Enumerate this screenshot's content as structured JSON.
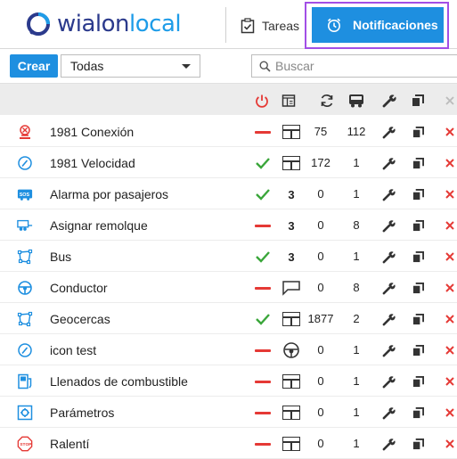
{
  "header": {
    "logo_primary": "wialon",
    "logo_secondary": "local",
    "tab_tasks": "Tareas",
    "tab_notifications": "Notificaciones"
  },
  "toolbar": {
    "create_label": "Crear",
    "filter_value": "Todas",
    "search_placeholder": "Buscar"
  },
  "columns": [
    "state-icon",
    "type-icon",
    "triggers-icon",
    "units-icon",
    "edit-icon",
    "copy-icon",
    "delete-icon"
  ],
  "colors": {
    "accent": "#1e8fe0",
    "highlight_frame": "#a24fe6",
    "active_check": "#3aa63a",
    "inactive_dash": "#e53935",
    "delete_red": "#e53935",
    "logo_dark": "#2b3a8c",
    "logo_light": "#1e9ce8"
  },
  "rows": [
    {
      "icon": "sos-siren-icon",
      "name": "1981 Conexión",
      "state": "inactive",
      "type_icon": "template",
      "type_text": "",
      "triggers": "75",
      "units": "112"
    },
    {
      "icon": "speedometer-icon",
      "name": "1981 Velocidad",
      "state": "active",
      "type_icon": "template",
      "type_text": "",
      "triggers": "172",
      "units": "1"
    },
    {
      "icon": "sos-bus-icon",
      "name": "Alarma por pasajeros",
      "state": "active",
      "type_icon": "",
      "type_text": "3",
      "triggers": "0",
      "units": "1"
    },
    {
      "icon": "trailer-icon",
      "name": "Asignar remolque",
      "state": "inactive",
      "type_icon": "",
      "type_text": "3",
      "triggers": "0",
      "units": "8"
    },
    {
      "icon": "geofence-icon",
      "name": "Bus",
      "state": "active",
      "type_icon": "",
      "type_text": "3",
      "triggers": "0",
      "units": "1"
    },
    {
      "icon": "steering-wheel-icon",
      "name": "Conductor",
      "state": "inactive",
      "type_icon": "message",
      "type_text": "",
      "triggers": "0",
      "units": "8"
    },
    {
      "icon": "geofence-icon",
      "name": "Geocercas",
      "state": "active",
      "type_icon": "template",
      "type_text": "",
      "triggers": "1877",
      "units": "2"
    },
    {
      "icon": "speedometer-icon",
      "name": "icon test",
      "state": "inactive",
      "type_icon": "driver",
      "type_text": "",
      "triggers": "0",
      "units": "1"
    },
    {
      "icon": "fuel-fill-icon",
      "name": "Llenados de combustible",
      "state": "inactive",
      "type_icon": "template",
      "type_text": "",
      "triggers": "0",
      "units": "1"
    },
    {
      "icon": "parameters-icon",
      "name": "Parámetros",
      "state": "inactive",
      "type_icon": "template",
      "type_text": "",
      "triggers": "0",
      "units": "1"
    },
    {
      "icon": "stop-sign-icon",
      "name": "Ralentí",
      "state": "inactive",
      "type_icon": "template",
      "type_text": "",
      "triggers": "0",
      "units": "1"
    }
  ]
}
